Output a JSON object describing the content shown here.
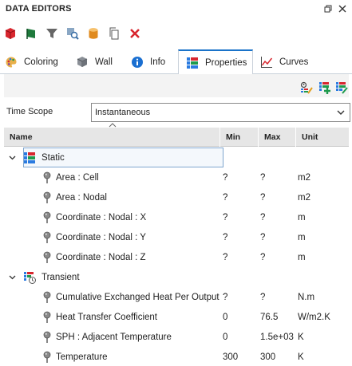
{
  "window": {
    "title": "Data Editors",
    "restore_icon": "restore-window-icon",
    "close_icon": "close-icon"
  },
  "toolbar": {
    "tools": [
      {
        "name": "cube-icon",
        "color": "#d8262e"
      },
      {
        "name": "flag-icon",
        "color": "#1e7a3c"
      },
      {
        "name": "filter-icon",
        "color": "#555555"
      },
      {
        "name": "find-icon",
        "color": "#3a6ea5"
      },
      {
        "name": "database-icon",
        "color": "#e08a1e"
      },
      {
        "name": "copy-icon",
        "color": "#555555"
      },
      {
        "name": "delete-icon",
        "color": "#d8262e"
      }
    ]
  },
  "tabs": [
    {
      "label": "Coloring",
      "icon": "palette-icon",
      "active": false
    },
    {
      "label": "Wall",
      "icon": "wall-icon",
      "active": false
    },
    {
      "label": "Info",
      "icon": "info-icon",
      "active": false
    },
    {
      "label": "Properties",
      "icon": "properties-icon",
      "active": true
    },
    {
      "label": "Curves",
      "icon": "curves-icon",
      "active": false
    }
  ],
  "strip_tools": [
    "edit-properties-icon",
    "add-property-icon",
    "import-properties-icon"
  ],
  "time_scope": {
    "label": "Time Scope",
    "value": "Instantaneous"
  },
  "table": {
    "columns": [
      "Name",
      "Min",
      "Max",
      "Unit"
    ],
    "groups": [
      {
        "name": "Static",
        "icon": "static-group-icon",
        "expanded": true,
        "selected": true,
        "rows": [
          {
            "name": "Area : Cell",
            "min": "?",
            "max": "?",
            "unit": "m2"
          },
          {
            "name": "Area : Nodal",
            "min": "?",
            "max": "?",
            "unit": "m2"
          },
          {
            "name": "Coordinate : Nodal : X",
            "min": "?",
            "max": "?",
            "unit": "m"
          },
          {
            "name": "Coordinate : Nodal : Y",
            "min": "?",
            "max": "?",
            "unit": "m"
          },
          {
            "name": "Coordinate : Nodal : Z",
            "min": "?",
            "max": "?",
            "unit": "m"
          }
        ]
      },
      {
        "name": "Transient",
        "icon": "transient-group-icon",
        "expanded": true,
        "selected": false,
        "rows": [
          {
            "name": "Cumulative Exchanged Heat Per Output",
            "min": "?",
            "max": "?",
            "unit": "N.m"
          },
          {
            "name": "Heat Transfer Coefficient",
            "min": "0",
            "max": "76.5",
            "unit": "W/m2.K"
          },
          {
            "name": "SPH : Adjacent Temperature",
            "min": "0",
            "max": "1.5e+03",
            "unit": "K"
          },
          {
            "name": "Temperature",
            "min": "300",
            "max": "300",
            "unit": "K"
          }
        ]
      }
    ]
  }
}
